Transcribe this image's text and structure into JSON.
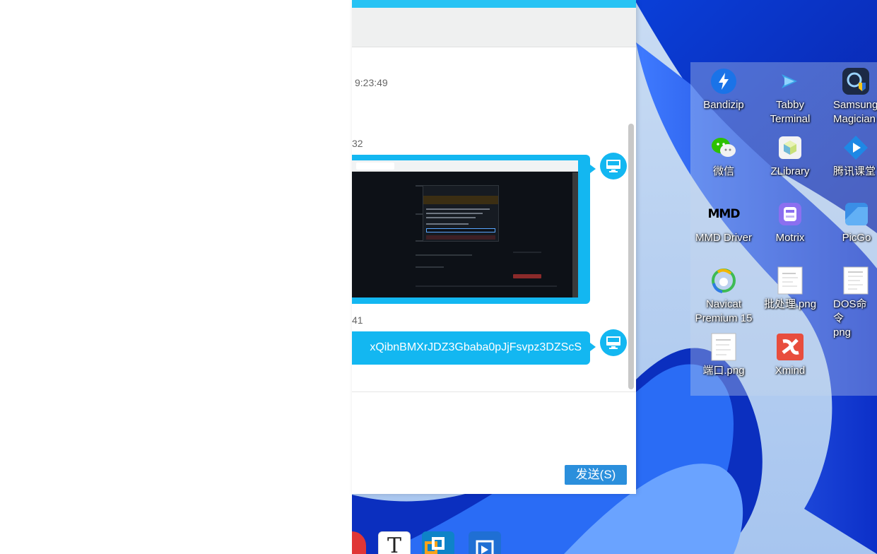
{
  "chat": {
    "timestamps": [
      "9:23:49",
      "32",
      "41"
    ],
    "messages": {
      "text_message": "xQibnBMXrJDZ3Gbaba0pJjFsvpz3DZScS"
    },
    "send_label": "发送(S)"
  },
  "desktop": {
    "icons": [
      {
        "label": "Bandizip",
        "icon": "bandizip-icon",
        "color": "#1a73e8"
      },
      {
        "label": "Tabby\nTerminal",
        "icon": "tabby-terminal-icon",
        "color": "#39a5e8"
      },
      {
        "label": "Samsung\nMagician",
        "icon": "samsung-magician-icon",
        "color": "#1c2a45"
      },
      {
        "label": "微信",
        "icon": "wechat-icon",
        "color": "#2dc100"
      },
      {
        "label": "ZLibrary",
        "icon": "zlibrary-icon",
        "color": "#f3f3f3"
      },
      {
        "label": "腾讯课堂",
        "icon": "tencent-classroom-icon",
        "color": "#1e88e5"
      },
      {
        "label": "MMD Driver",
        "icon": "mmd-driver-icon",
        "color": "#000000"
      },
      {
        "label": "Motrix",
        "icon": "motrix-icon",
        "color": "#8b6ff0"
      },
      {
        "label": "PicGo",
        "icon": "picgo-icon",
        "color": "#3a8ee6"
      },
      {
        "label": "Navicat\nPremium 15",
        "icon": "navicat-icon",
        "color": "#3dbb54"
      },
      {
        "label": "批处理.png",
        "icon": "image-file-icon",
        "color": "#ffffff"
      },
      {
        "label": "DOS命令\npng",
        "icon": "image-file-icon",
        "color": "#ffffff"
      },
      {
        "label": "端口.png",
        "icon": "image-file-icon",
        "color": "#ffffff"
      },
      {
        "label": "Xmind",
        "icon": "xmind-icon",
        "color": "#e84d3d"
      }
    ],
    "icon_texts": {
      "mmd": "MMD"
    }
  },
  "taskbar": {
    "items": [
      "netease-music-icon",
      "typora-icon",
      "vmware-icon",
      "remote-desktop-icon"
    ]
  }
}
